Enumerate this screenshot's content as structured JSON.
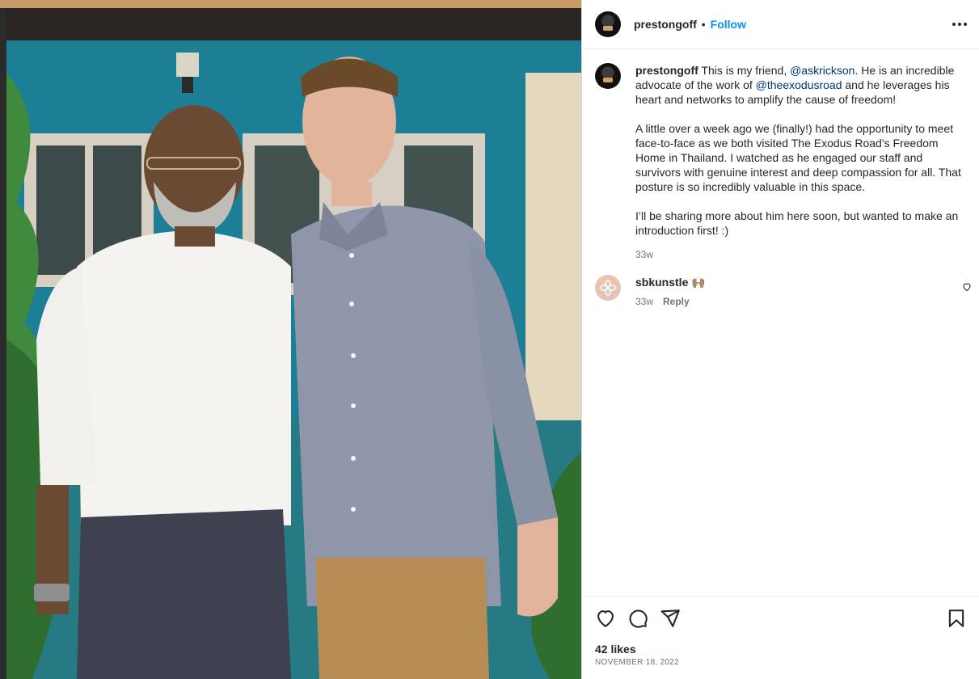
{
  "post": {
    "author": "prestongoff",
    "follow_label": "Follow",
    "separator": "•",
    "photo_icon": "post-photo"
  },
  "caption": {
    "username": "prestongoff",
    "p1_a": " This is my friend, ",
    "mention1": "@askrickson",
    "p1_b": ". He is an incredible advocate of the work of ",
    "mention2": "@theexodusroad",
    "p1_c": " and he leverages his heart and networks to amplify the cause of freedom!",
    "p2": "A little over a week ago we (finally!) had the opportunity to meet face-to-face as we both visited The Exodus Road’s Freedom Home in Thailand. I watched as he engaged our staff and survivors with genuine interest and deep compassion for all. That posture is so incredibly valuable in this space.",
    "p3": "I’ll be sharing more about him here soon, but wanted to make an introduction first! :)",
    "time": "33w"
  },
  "comments": [
    {
      "username": "sbkunstle",
      "emoji": "🙌🏽",
      "time": "33w",
      "reply_label": "Reply"
    }
  ],
  "footer": {
    "likes": "42 likes",
    "date": "NOVEMBER 18, 2022"
  },
  "icons": {
    "like": "heart-icon",
    "comment": "comment-icon",
    "share": "send-icon",
    "save": "bookmark-icon",
    "more": "more-options-icon"
  },
  "colors": {
    "link": "#0095f6",
    "mention": "#00376b",
    "muted": "#737373"
  }
}
